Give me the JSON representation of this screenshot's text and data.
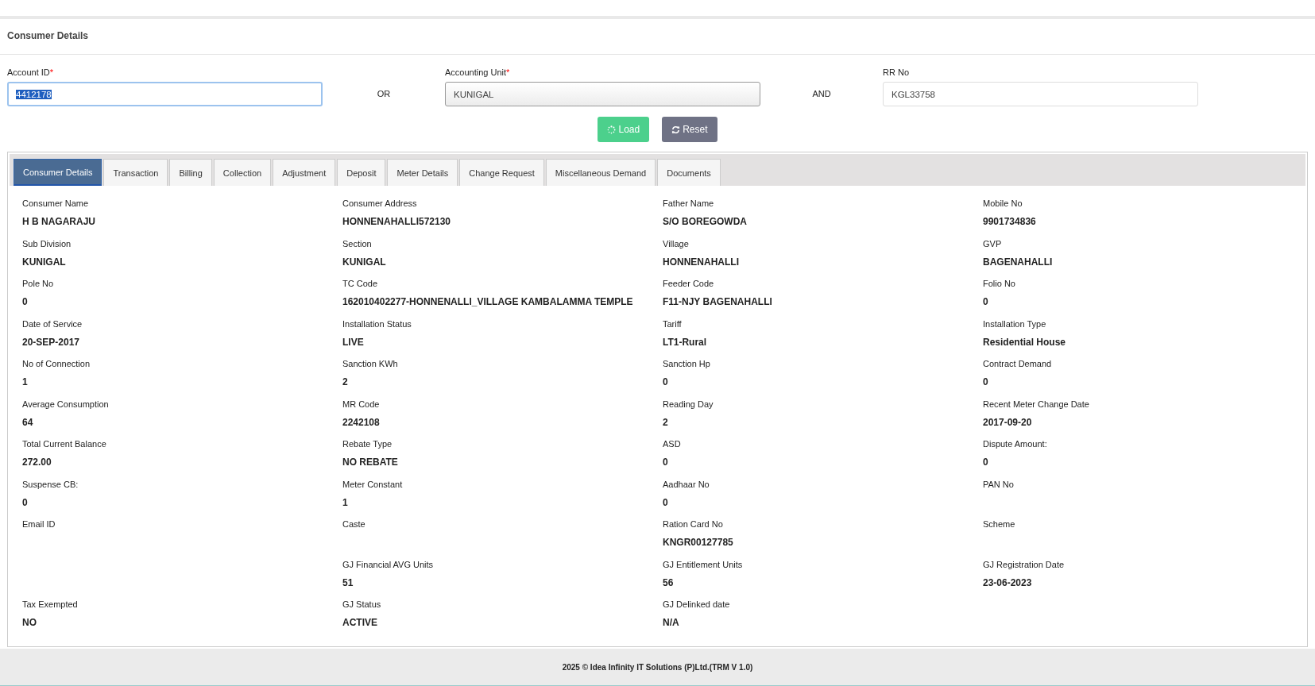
{
  "page_title": "Consumer Details",
  "search": [
    {
      "label": "Account ID",
      "required_mark": "*",
      "value": "4412178",
      "highlighted": true,
      "kind": "input"
    },
    {
      "label": "Accounting Unit",
      "required_mark": "*",
      "value": "KUNIGAL",
      "highlighted": false,
      "kind": "select"
    },
    {
      "label": "RR No",
      "value": "KGL33758",
      "highlighted": false,
      "kind": "input"
    }
  ],
  "connectors": [
    "OR",
    "AND"
  ],
  "buttons": [
    {
      "label": "Load",
      "kind": "load"
    },
    {
      "label": "Reset",
      "kind": "reset"
    }
  ],
  "tabs": [
    {
      "label": "Consumer Details",
      "selected": true
    },
    {
      "label": "Transaction",
      "selected": false
    },
    {
      "label": "Billing",
      "selected": false
    },
    {
      "label": "Collection",
      "selected": false
    },
    {
      "label": "Adjustment",
      "selected": false
    },
    {
      "label": "Deposit",
      "selected": false
    },
    {
      "label": "Meter Details",
      "selected": false
    },
    {
      "label": "Change Request",
      "selected": false
    },
    {
      "label": "Miscellaneous Demand",
      "selected": false
    },
    {
      "label": "Documents",
      "selected": false
    }
  ],
  "details": [
    [
      {
        "label": "Consumer Name",
        "value": "H B NAGARAJU"
      },
      {
        "label": "Consumer Address",
        "value": "HONNENAHALLI572130"
      },
      {
        "label": "Father Name",
        "value": "S/O BOREGOWDA"
      },
      {
        "label": "Mobile No",
        "value": "9901734836"
      }
    ],
    [
      {
        "label": "Sub Division",
        "value": "KUNIGAL"
      },
      {
        "label": "Section",
        "value": "KUNIGAL"
      },
      {
        "label": "Village",
        "value": "HONNENAHALLI"
      },
      {
        "label": "GVP",
        "value": "BAGENAHALLI"
      }
    ],
    [
      {
        "label": "Pole No",
        "value": "0"
      },
      {
        "label": "TC Code",
        "value": "162010402277-HONNENALLI_VILLAGE KAMBALAMMA TEMPLE"
      },
      {
        "label": "Feeder Code",
        "value": "F11-NJY BAGENAHALLI"
      },
      {
        "label": "Folio No",
        "value": "0"
      }
    ],
    [
      {
        "label": "Date of Service",
        "value": "20-SEP-2017"
      },
      {
        "label": "Installation Status",
        "value": "LIVE"
      },
      {
        "label": "Tariff",
        "value": "LT1-Rural"
      },
      {
        "label": "Installation Type",
        "value": "Residential House"
      }
    ],
    [
      {
        "label": "No of Connection",
        "value": "1"
      },
      {
        "label": "Sanction KWh",
        "value": "2"
      },
      {
        "label": "Sanction Hp",
        "value": "0"
      },
      {
        "label": "Contract Demand",
        "value": "0"
      }
    ],
    [
      {
        "label": "Average Consumption",
        "value": "64"
      },
      {
        "label": "MR Code",
        "value": "2242108"
      },
      {
        "label": "Reading Day",
        "value": "2"
      },
      {
        "label": "Recent Meter Change Date",
        "value": "2017-09-20"
      }
    ],
    [
      {
        "label": "Total Current Balance",
        "value": "272.00"
      },
      {
        "label": "Rebate Type",
        "value": "NO REBATE"
      },
      {
        "label": "ASD",
        "value": "0"
      },
      {
        "label": "Dispute Amount:",
        "value": "0"
      }
    ],
    [
      {
        "label": "Suspense CB:",
        "value": "0"
      },
      {
        "label": "Meter Constant",
        "value": "1"
      },
      {
        "label": "Aadhaar No",
        "value": "0"
      },
      {
        "label": "PAN No"
      }
    ],
    [
      {
        "label": "Email ID"
      },
      {
        "label": "Caste"
      },
      {
        "label": "Ration Card No",
        "value": "KNGR00127785"
      },
      {
        "label": "Scheme"
      }
    ],
    [
      {
        "label": "GJ Financial AVG Units",
        "value": "51"
      },
      {
        "label": "GJ Entitlement Units",
        "value": "56"
      },
      {
        "label": "GJ Registration Date",
        "value": "23-06-2023"
      }
    ],
    [
      {
        "label": "Tax Exempted",
        "value": "NO"
      },
      {
        "label": "GJ Status",
        "value": "ACTIVE"
      },
      {
        "label": "GJ Delinked date",
        "value": "N/A"
      }
    ]
  ],
  "footer": "2025 © Idea Infinity IT Solutions (P)Ltd.(TRM V 1.0)"
}
